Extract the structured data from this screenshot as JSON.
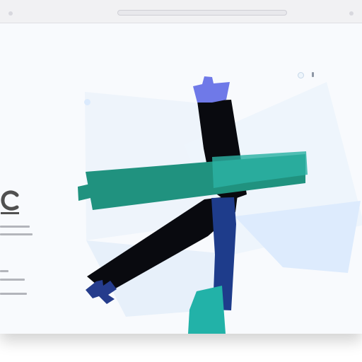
{
  "window": {
    "address_bar": ""
  },
  "hero": {
    "logo_glyph": "C"
  },
  "sidebar": {
    "lines": [
      "",
      "",
      "",
      "",
      "",
      ""
    ]
  },
  "colors": {
    "accent_teal": "#2a9a8b",
    "accent_black": "#090a0f",
    "accent_blue": "#253c8c",
    "accent_lavender": "#6f79e8",
    "accent_red": "#f15b54",
    "background": "#f8fafd"
  }
}
